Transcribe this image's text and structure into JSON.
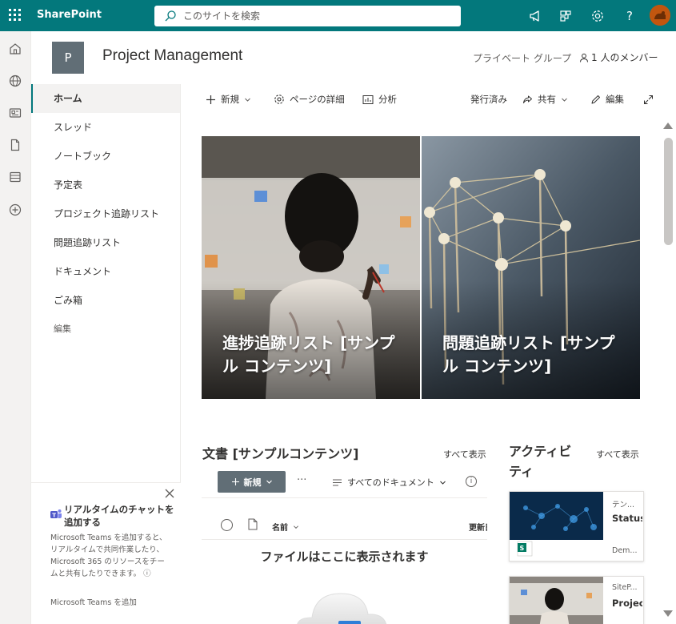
{
  "suitebar": {
    "brand": "SharePoint",
    "search_placeholder": "このサイトを検索",
    "icons": [
      "megaphone-icon",
      "share-network-icon",
      "gear-icon",
      "help-icon",
      "avatar"
    ],
    "help_glyph": "?",
    "bg_color": "#03787c"
  },
  "rail": {
    "icons": [
      "home-icon",
      "globe-icon",
      "news-icon",
      "document-icon",
      "list-icon",
      "add-icon"
    ]
  },
  "site": {
    "logo_letter": "P",
    "title": "Project Management",
    "privacy": "プライベート グループ",
    "members": "1 人のメンバー"
  },
  "nav": {
    "items": [
      {
        "label": "ホーム",
        "active": true
      },
      {
        "label": "スレッド"
      },
      {
        "label": "ノートブック"
      },
      {
        "label": "予定表"
      },
      {
        "label": "プロジェクト追跡リスト"
      },
      {
        "label": "問題追跡リスト"
      },
      {
        "label": "ドキュメント"
      },
      {
        "label": "ごみ箱"
      },
      {
        "label": "編集"
      }
    ]
  },
  "teams_card": {
    "title": "リアルタイムのチャットを追加する",
    "description": "Microsoft Teams を追加すると、リアルタイムで共同作業したり、Microsoft 365 のリソースをチームと共有したりできます。",
    "info_glyph": "ⓘ",
    "link": "Microsoft Teams を追加"
  },
  "commandbar": {
    "new": "新規",
    "page_details": "ページの詳細",
    "analytics": "分析",
    "published": "発行済み",
    "share": "共有",
    "edit": "編集"
  },
  "hero": {
    "left_caption": "進捗追跡リスト [サンプル コンテンツ]",
    "right_caption": "問題追跡リスト [サンプル コンテンツ]"
  },
  "documents": {
    "title": "文書 [サンプルコンテンツ]",
    "see_all": "すべて表示",
    "new_button": "新規",
    "more": "···",
    "view": "すべてのドキュメント",
    "info": "i",
    "col_name": "名前",
    "col_modified": "更新日時",
    "empty": "ファイルはここに表示されます"
  },
  "activity": {
    "title": "アクティビティ",
    "see_all": "すべて表示",
    "cards": [
      {
        "meta": "テン...",
        "title": "Status-...",
        "author": "Dem..."
      },
      {
        "meta": "SiteP...",
        "title": "ProjectH..."
      }
    ]
  }
}
